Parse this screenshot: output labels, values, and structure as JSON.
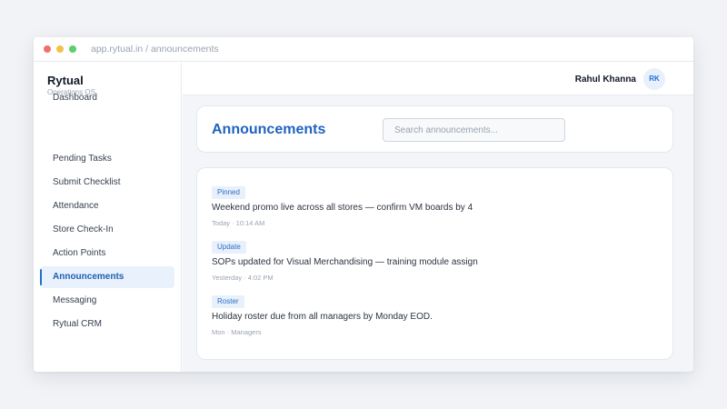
{
  "browser": {
    "url": "app.rytual.in / announcements"
  },
  "sidebar": {
    "brand": "Rytual",
    "brand_sub": "Operations OS",
    "items": [
      {
        "label": "Dashboard"
      },
      {
        "label": "Pending Tasks"
      },
      {
        "label": "Submit Checklist"
      },
      {
        "label": "Attendance"
      },
      {
        "label": "Store Check-In"
      },
      {
        "label": "Action Points"
      },
      {
        "label": "Announcements",
        "active": true
      },
      {
        "label": "Messaging"
      },
      {
        "label": "Rytual CRM"
      }
    ]
  },
  "topbar": {
    "user_name": "Rahul Khanna",
    "avatar_initials": "RK"
  },
  "page": {
    "title": "Announcements",
    "search_placeholder": "Search announcements..."
  },
  "announcements": [
    {
      "tag": "Pinned",
      "text": "Weekend promo live across all stores — confirm VM boards by 4",
      "meta": "Today · 10:14 AM"
    },
    {
      "tag": "Update",
      "text": "SOPs updated for Visual Merchandising — training module assign",
      "meta": "Yesterday · 4:02 PM"
    },
    {
      "tag": "Roster",
      "text": "Holiday roster due from all managers by Monday EOD.",
      "meta": "Mon · Managers"
    }
  ],
  "colors": {
    "accent": "#1f6fd6",
    "title": "#1f63c0",
    "active_bg": "#e9f1fc",
    "tag_bg": "#e8f0fb"
  }
}
